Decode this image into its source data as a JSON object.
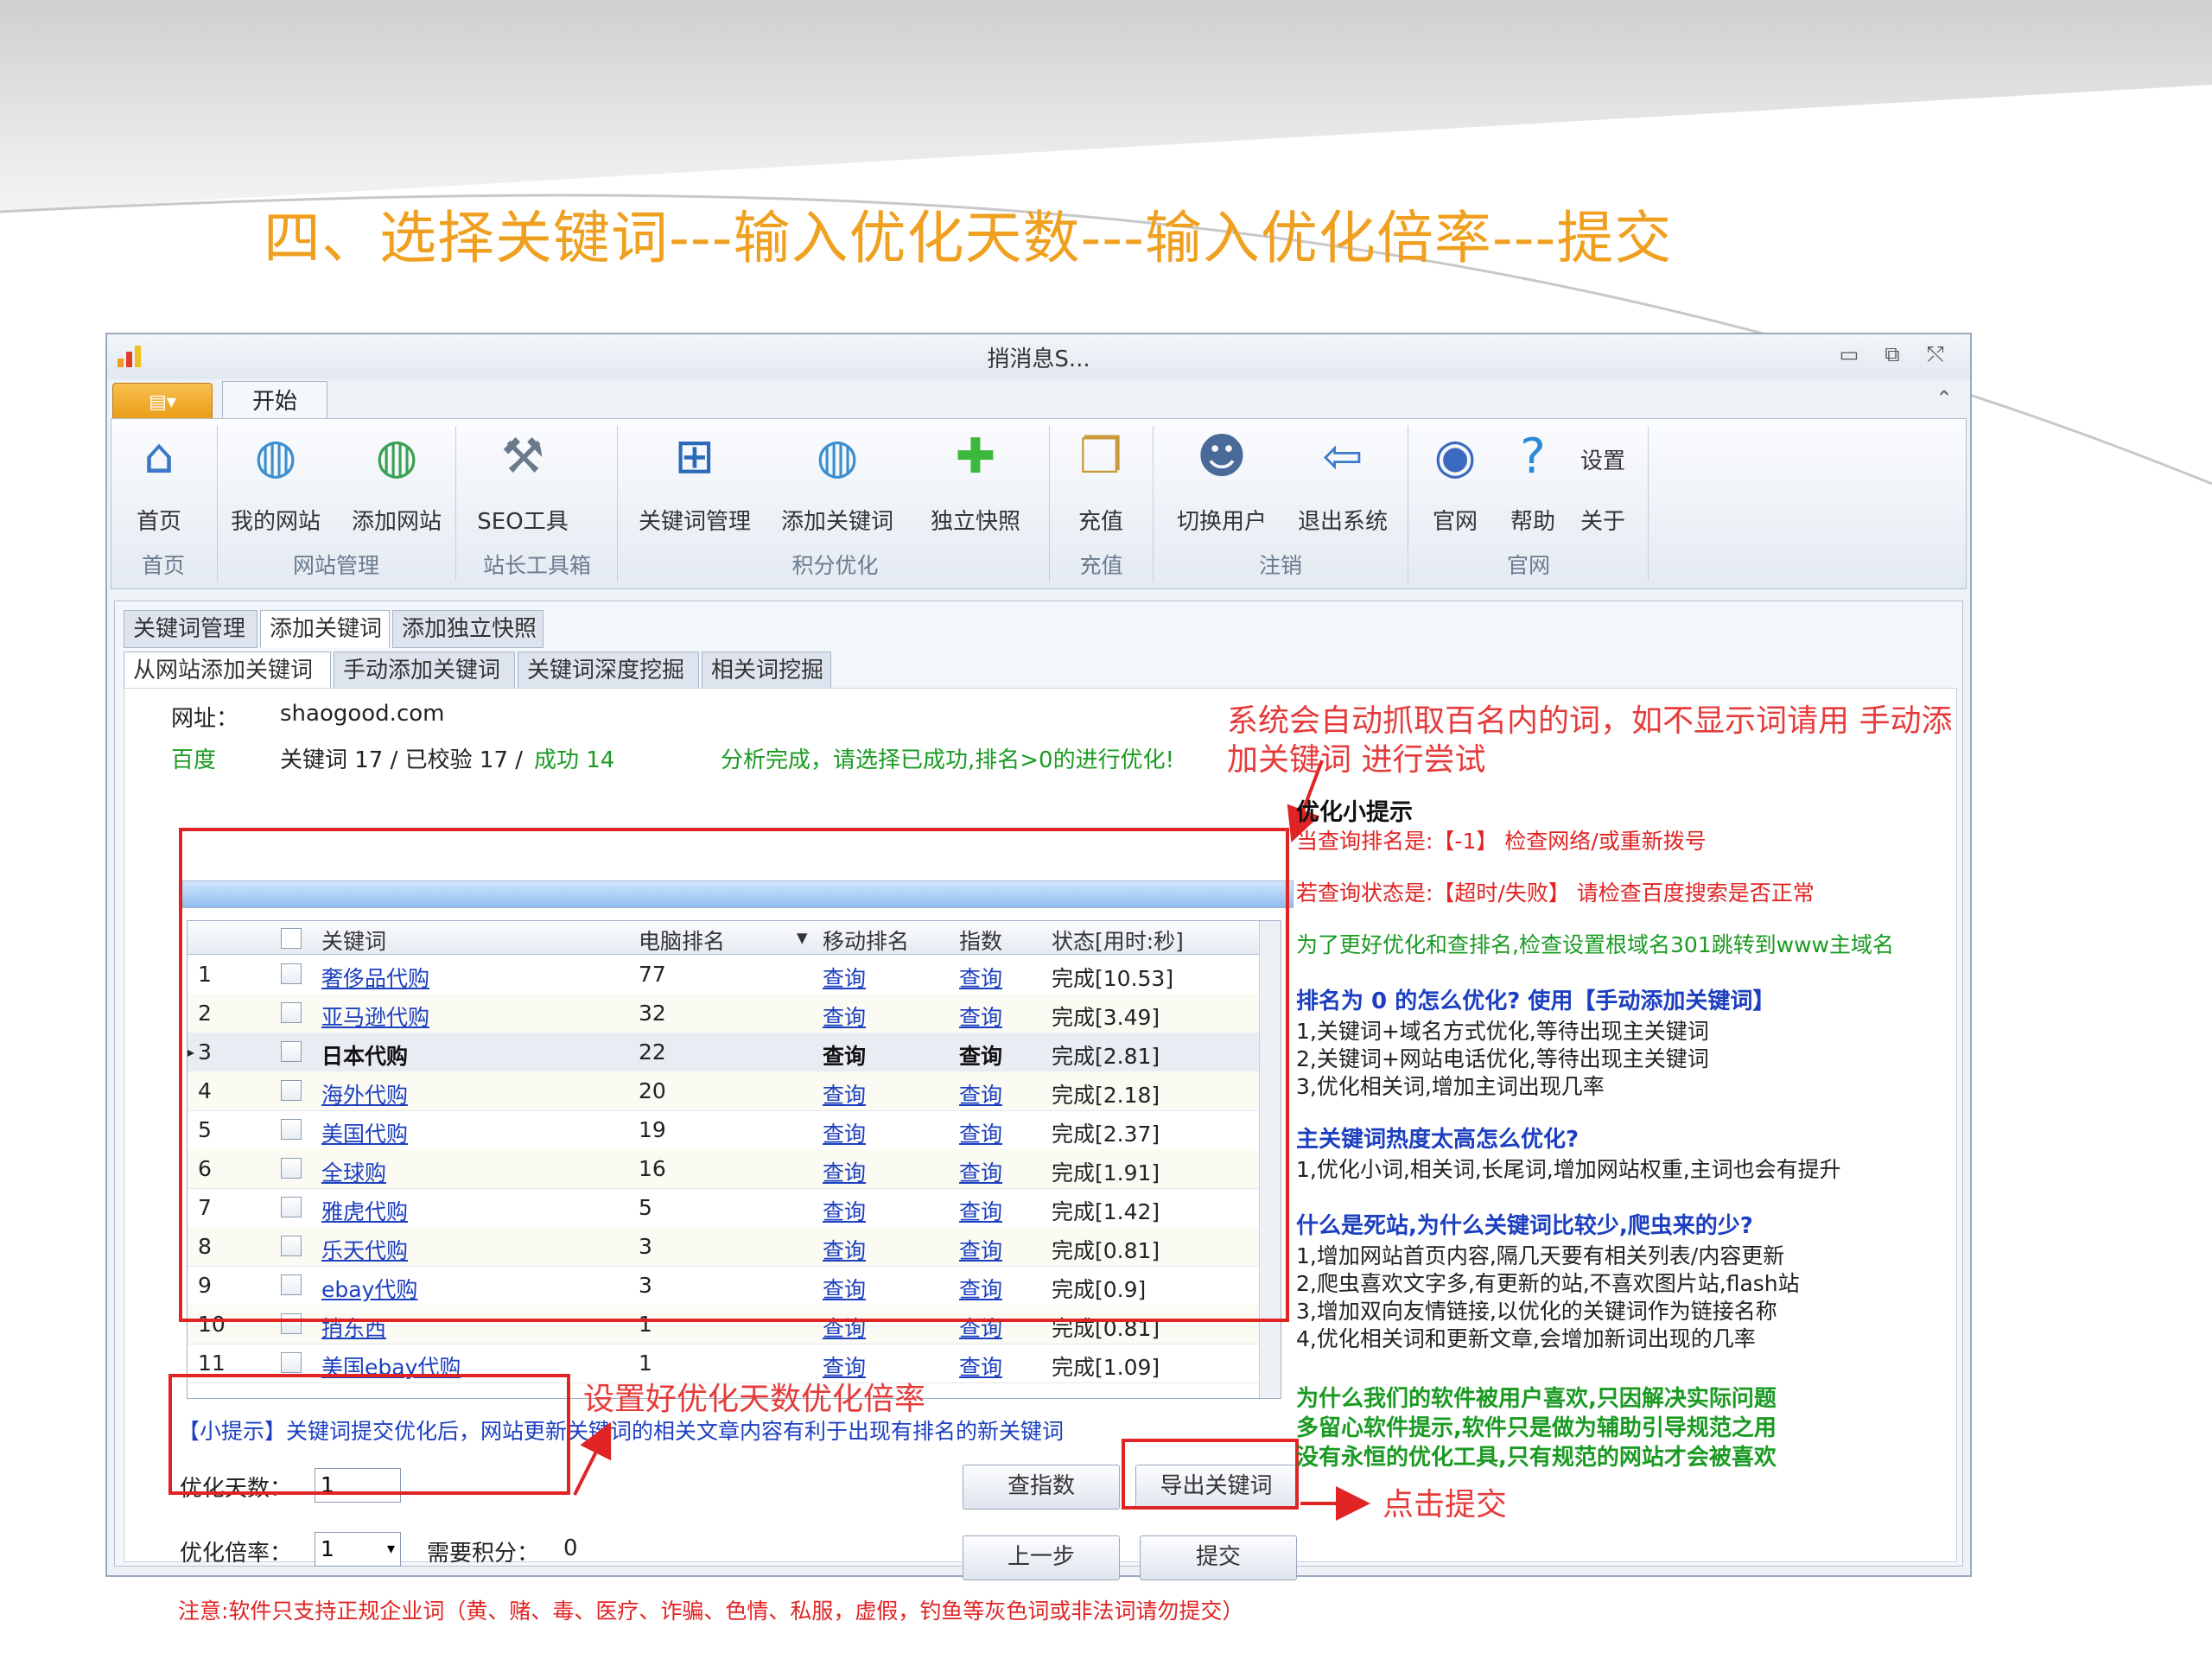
{
  "slide": {
    "title": "四、选择关键词---输入优化天数---输入优化倍率---提交"
  },
  "window": {
    "title": "捎消息S...",
    "controls": {
      "minimize": "▭",
      "restore": "⧉",
      "close": "⤲"
    }
  },
  "ribbon": {
    "app_menu": "▤▾",
    "tab_start": "开始",
    "buttons": [
      {
        "label": "首页",
        "icon": "home-icon"
      },
      {
        "label": "我的网站",
        "icon": "globe-icon"
      },
      {
        "label": "添加网站",
        "icon": "globe-add-icon"
      },
      {
        "label": "SEO工具",
        "icon": "tools-icon"
      },
      {
        "label": "关键词管理",
        "icon": "network-icon"
      },
      {
        "label": "添加关键词",
        "icon": "globe-add-icon"
      },
      {
        "label": "独立快照",
        "icon": "plus-icon"
      },
      {
        "label": "充值",
        "icon": "docs-icon"
      },
      {
        "label": "切换用户",
        "icon": "users-icon"
      },
      {
        "label": "退出系统",
        "icon": "exit-icon"
      },
      {
        "label": "官网",
        "icon": "bubble-icon"
      },
      {
        "label": "帮助",
        "icon": "help-icon"
      }
    ],
    "small_buttons": {
      "settings": "设置",
      "about": "关于"
    },
    "groups": [
      "首页",
      "网站管理",
      "站长工具箱",
      "积分优化",
      "充值",
      "注销",
      "官网"
    ]
  },
  "tabs_outer": [
    "关键词管理",
    "添加关键词",
    "添加独立快照"
  ],
  "tabs_inner": [
    "从网站添加关键词",
    "手动添加关键词",
    "关键词深度挖掘",
    "相关词挖掘"
  ],
  "site": {
    "url_label": "网址：",
    "url": "shaogood.com",
    "engine": "百度",
    "stats": "关键词 17 / 已校验 17 / ",
    "success": "成功 14",
    "status": "分析完成，请选择已成功,排名>0的进行优化!",
    "progress_fraction": 1.0
  },
  "grid": {
    "columns": [
      "关键词",
      "电脑排名",
      "移动排名",
      "指数",
      "状态[用时:秒]"
    ],
    "sort_indicator": "▾",
    "rows": [
      {
        "no": "1",
        "kw": "奢侈品代购",
        "pc": "77",
        "mobile": "查询",
        "index": "查询",
        "status": "完成[10.53]"
      },
      {
        "no": "2",
        "kw": "亚马逊代购",
        "pc": "32",
        "mobile": "查询",
        "index": "查询",
        "status": "完成[3.49]"
      },
      {
        "no": "3",
        "kw": "日本代购",
        "pc": "22",
        "mobile": "查询",
        "index": "查询",
        "status": "完成[2.81]"
      },
      {
        "no": "4",
        "kw": "海外代购",
        "pc": "20",
        "mobile": "查询",
        "index": "查询",
        "status": "完成[2.18]"
      },
      {
        "no": "5",
        "kw": "美国代购",
        "pc": "19",
        "mobile": "查询",
        "index": "查询",
        "status": "完成[2.37]"
      },
      {
        "no": "6",
        "kw": "全球购",
        "pc": "16",
        "mobile": "查询",
        "index": "查询",
        "status": "完成[1.91]"
      },
      {
        "no": "7",
        "kw": "雅虎代购",
        "pc": "5",
        "mobile": "查询",
        "index": "查询",
        "status": "完成[1.42]"
      },
      {
        "no": "8",
        "kw": "乐天代购",
        "pc": "3",
        "mobile": "查询",
        "index": "查询",
        "status": "完成[0.81]"
      },
      {
        "no": "9",
        "kw": "ebay代购",
        "pc": "3",
        "mobile": "查询",
        "index": "查询",
        "status": "完成[0.9]"
      },
      {
        "no": "10",
        "kw": "捎东西",
        "pc": "1",
        "mobile": "查询",
        "index": "查询",
        "status": "完成[0.81]"
      },
      {
        "no": "11",
        "kw": "美国ebay代购",
        "pc": "1",
        "mobile": "查询",
        "index": "查询",
        "status": "完成[1.09]"
      }
    ]
  },
  "hint_bottom": "【小提示】关键词提交优化后，网站更新关键词的相关文章内容有利于出现有排名的新关键词",
  "form": {
    "days_label": "优化天数：",
    "days_value": "1",
    "multiplier_label": "优化倍率：",
    "multiplier_value": "1",
    "points_label": "需要积分：",
    "points_value": "0"
  },
  "buttons": {
    "query_index": "查指数",
    "export": "导出关键词",
    "prev": "上一步",
    "submit": "提交"
  },
  "notice": "注意:软件只支持正规企业词（黄、赌、毒、医疗、诈骗、色情、私服，虚假，钓鱼等灰色词或非法词请勿提交）",
  "annotations": {
    "top_right_1": "系统会自动抓取百名内的词，如不显示词请用 手动添",
    "top_right_2": "加关键词 进行尝试",
    "settings_note": "设置好优化天数优化倍率",
    "submit_note": "点击提交"
  },
  "tips": {
    "title": "优化小提示",
    "t1": "当查询排名是:【-1】 检查网络/或重新拨号",
    "t2": "若查询状态是:【超时/失败】 请检查百度搜索是否正常",
    "t3": "为了更好优化和查排名,检查设置根域名301跳转到www主域名",
    "q1": "排名为 0 的怎么优化? 使用【手动添加关键词】",
    "q1a": "1,关键词+域名方式优化,等待出现主关键词",
    "q1b": "2,关键词+网站电话优化,等待出现主关键词",
    "q1c": "3,优化相关词,增加主词出现几率",
    "q2": "主关键词热度太高怎么优化?",
    "q2a": "1,优化小词,相关词,长尾词,增加网站权重,主词也会有提升",
    "q3": "什么是死站,为什么关键词比较少,爬虫来的少?",
    "q3a": "1,增加网站首页内容,隔几天要有相关列表/内容更新",
    "q3b": "2,爬虫喜欢文字多,有更新的站,不喜欢图片站,flash站",
    "q3c": "3,增加双向友情链接,以优化的关键词作为链接名称",
    "q3d": "4,优化相关词和更新文章,会增加新词出现的几率",
    "g1": "为什么我们的软件被用户喜欢,只因解决实际问题",
    "g2": "多留心软件提示,软件只是做为辅助引导规范之用",
    "g3": "没有永恒的优化工具,只有规范的网站才会被喜欢"
  },
  "colors": {
    "title": "#f0a020",
    "annotation_red": "#e53b3b",
    "link_blue": "#1c3fc0",
    "tip_green": "#1a9a22"
  }
}
